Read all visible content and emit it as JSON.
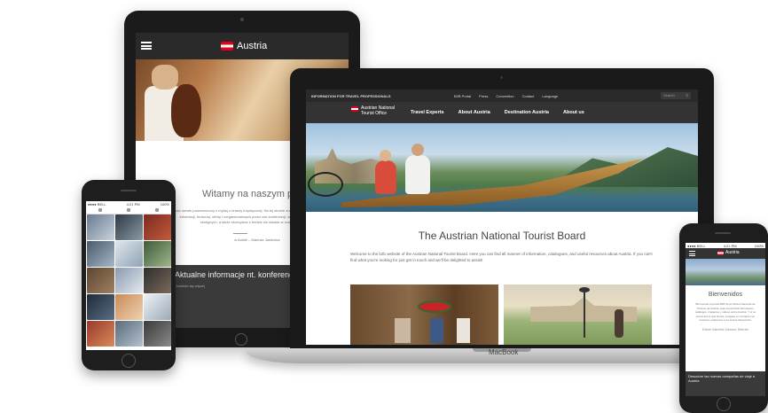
{
  "tablet": {
    "brand": "Austria",
    "welcome": "Witamy na naszym portalu B",
    "body": "Nasz serwis przeznaczony z myślą o branży turystycznej. Na tej stronie znajdą Państwo wiele praktycznych informacji, broszury, oferty i zorganizowanych przez nas konferencji, webinariów, targów, wyjazdów studyjnych, a także skorzystać z bedzie sie działać w codziennym ruchu.",
    "footer_note": "w Austrii – Mariusz Jasiewicz",
    "news_title": "Aktualne informacje nt. konferencji w Austrii",
    "news_small": "Dowiedz się więcej"
  },
  "phone_left": {
    "status_left": "●●●● BELL",
    "status_time": "4:21 PM",
    "status_right": "100%"
  },
  "laptop": {
    "util_pro": "INFORMATION FOR TRAVEL PROFESSIONALS",
    "util_links": [
      "B2B Portal",
      "Press",
      "Convention",
      "Contact",
      "Language"
    ],
    "search_placeholder": "Search",
    "logo_line1": "Austrian National",
    "logo_line2": "Tourist Office",
    "menu": [
      "Travel Experts",
      "About Austria",
      "Destination Austria",
      "About us"
    ],
    "headline": "The Austrian National Tourist Board",
    "intro": "Welcome to the b2b website of the Austrian National Tourist Board. Here you can find all manner of information, catalogues, and useful resources about Austria. If you can't find what you're looking for just get in touch and we'll be delighted to assist!",
    "base_label": "MacBook"
  },
  "phone_right": {
    "status_left": "●●●● BELL",
    "status_time": "4:21 PM",
    "status_right": "100%",
    "brand": "Austria",
    "title": "Bienvenidos",
    "body": "Bienvenido al portal B2B de la Oficina Nacional de Turismo de Austria. Aquí encontrará información, catálogos, imágenes y videos sobre Austria. Y si no encuentra lo que busca, póngase en contacto con nosotros, estaremos a su entera disposición.",
    "signature": "Esther Sánchez Zamora, Director",
    "news": "Descubre las nuevas campañas de viaje a Austria"
  }
}
